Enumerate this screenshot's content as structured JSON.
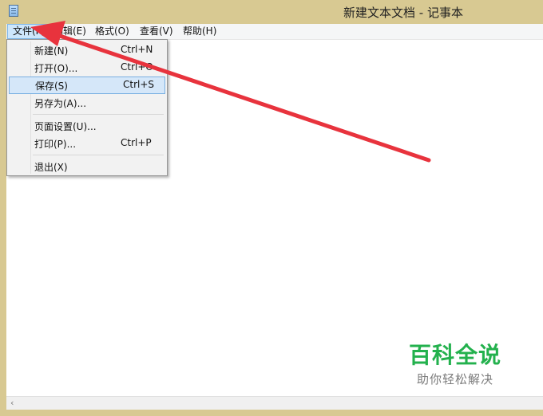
{
  "window": {
    "title": "新建文本文档 - 记事本",
    "icon": "notepad-icon"
  },
  "menubar": {
    "items": [
      {
        "label": "文件(F)",
        "active": true
      },
      {
        "label": "编辑(E)"
      },
      {
        "label": "格式(O)"
      },
      {
        "label": "查看(V)"
      },
      {
        "label": "帮助(H)"
      }
    ]
  },
  "file_menu": {
    "items": [
      {
        "label": "新建(N)",
        "shortcut": "Ctrl+N"
      },
      {
        "label": "打开(O)...",
        "shortcut": "Ctrl+O"
      },
      {
        "label": "保存(S)",
        "shortcut": "Ctrl+S",
        "highlighted": true
      },
      {
        "label": "另存为(A)...",
        "shortcut": ""
      },
      {
        "label": "页面设置(U)...",
        "shortcut": ""
      },
      {
        "label": "打印(P)...",
        "shortcut": "Ctrl+P"
      },
      {
        "label": "退出(X)",
        "shortcut": ""
      }
    ]
  },
  "watermark": {
    "main": "百科全说",
    "sub": "助你轻松解决"
  },
  "colors": {
    "arrow": "#e8333d",
    "watermark_green": "#23b14d",
    "highlight": "#d5e7f9"
  }
}
